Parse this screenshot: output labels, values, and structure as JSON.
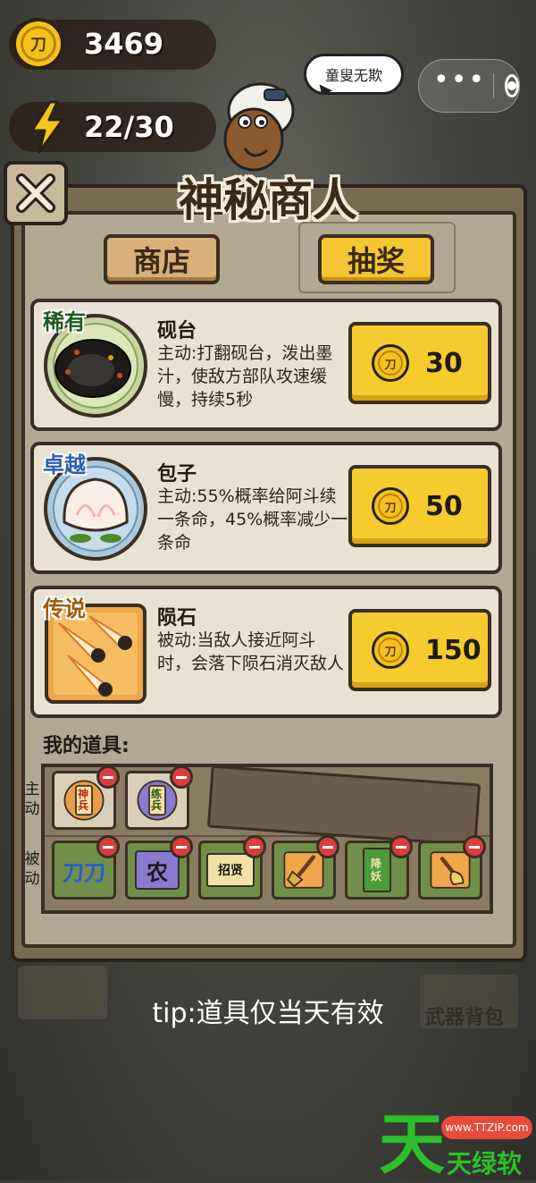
{
  "hud": {
    "coins": "3469",
    "energy": "22/30",
    "coin_glyph": "刀"
  },
  "miniprogram": {
    "more_dots": "•••"
  },
  "merchant": {
    "speech": "童叟无欺",
    "title": "神秘商人"
  },
  "tabs": {
    "shop": "商店",
    "draw": "抽奖"
  },
  "items": [
    {
      "rarity": "稀有",
      "name": "砚台",
      "desc": "主动:打翻砚台，泼出墨汁，使敌方部队攻速缓慢，持续5秒",
      "price": "30"
    },
    {
      "rarity": "卓越",
      "name": "包子",
      "desc": "主动:55%概率给阿斗续一条命，45%概率减少一条命",
      "price": "50"
    },
    {
      "rarity": "传说",
      "name": "陨石",
      "desc": "被动:当敌人接近阿斗时，会落下陨石消灭敌人",
      "price": "150"
    }
  ],
  "my_items": {
    "label": "我的道具:",
    "active_label": "主动",
    "passive_label": "被动",
    "active_slots": [
      {
        "glyph": "神兵"
      },
      {
        "glyph": "练兵"
      }
    ],
    "passive_slots": [
      {
        "glyph": "刀刀"
      },
      {
        "glyph": "农"
      },
      {
        "glyph": "招贤"
      },
      {
        "glyph": "shovel-icon"
      },
      {
        "glyph": "降妖"
      },
      {
        "glyph": "hand-shovel-icon"
      }
    ]
  },
  "footer": {
    "tip": "tip:道具仅当天有效",
    "bag": "武器背包"
  },
  "watermark": {
    "big": "天",
    "text": "天绿软",
    "url": "www.TTZIP.com"
  },
  "colors": {
    "gold": "#f6cb2e",
    "panel": "#b3a891",
    "card": "#e9e2d2",
    "rare_green": "#1f5c1c",
    "epic_blue": "#2b5fb0",
    "legend_orange": "#a15a0a",
    "minus_red": "#d93e3e"
  }
}
